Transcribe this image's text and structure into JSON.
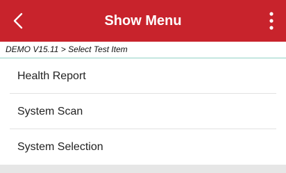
{
  "colors": {
    "appbar": "#c8232c",
    "breadcrumb_border": "#8fd1c4",
    "footer_band": "#e6e6e6"
  },
  "header": {
    "title": "Show Menu",
    "back_icon": "chevron-left-icon",
    "more_icon": "more-vertical-icon"
  },
  "breadcrumb": {
    "text": "DEMO V15.11 > Select Test Item"
  },
  "menu": {
    "items": [
      {
        "label": "Health Report"
      },
      {
        "label": "System Scan"
      },
      {
        "label": "System Selection"
      }
    ]
  }
}
